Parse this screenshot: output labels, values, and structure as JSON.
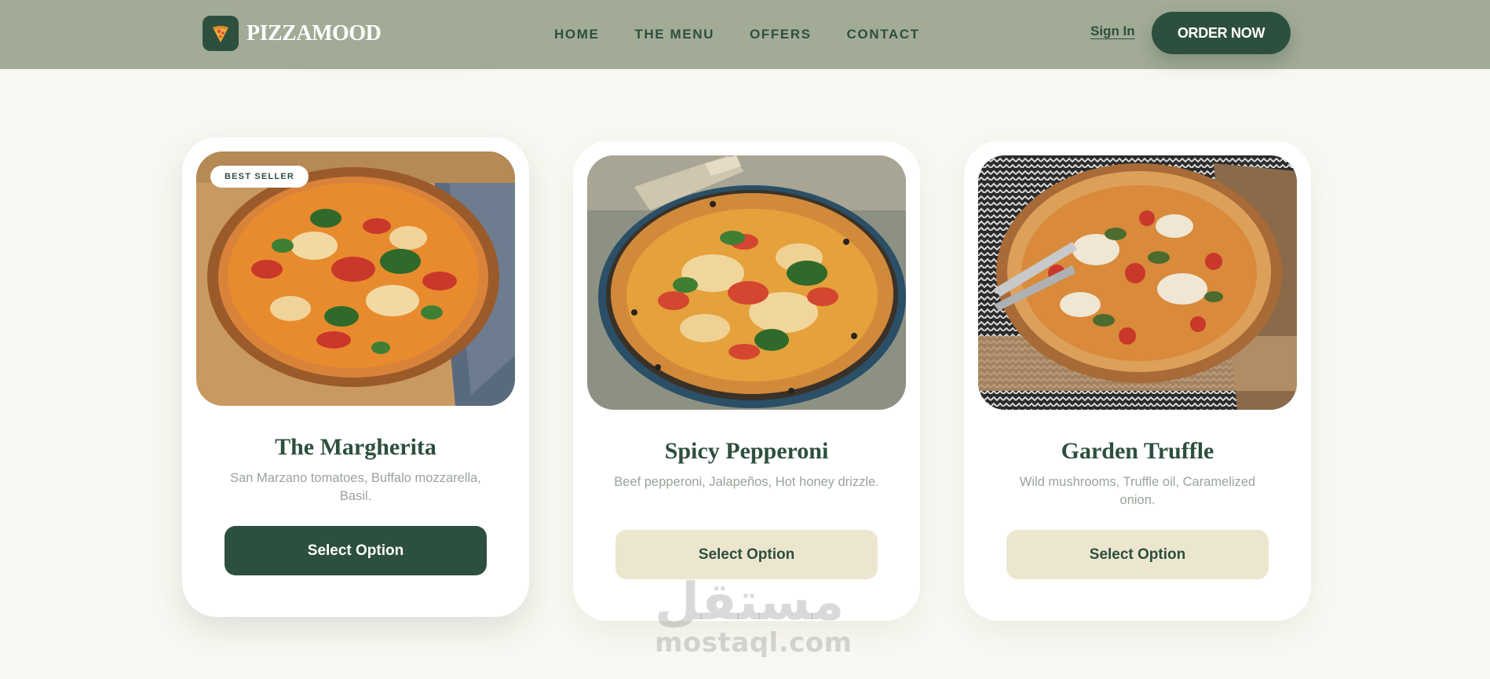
{
  "brand": {
    "name_part1": "PIZZA",
    "name_part2": "MOOD",
    "accent_color": "#2d4f3e",
    "header_color": "#a2ab96",
    "cream_color": "#ede6cf"
  },
  "nav": {
    "items": [
      "HOME",
      "THE MENU",
      "OFFERS",
      "CONTACT"
    ],
    "sign_in": "Sign In",
    "order_now": "ORDER NOW"
  },
  "cards": [
    {
      "badge": "BEST SELLER",
      "title": "The Margherita",
      "description": "San Marzano tomatoes, Buffalo mozzarella, Basil.",
      "button": "Select Option",
      "image": "pizza-margherita-photo",
      "featured": true
    },
    {
      "title": "Spicy Pepperoni",
      "description": "Beef pepperoni, Jalapeños, Hot honey drizzle.",
      "button": "Select Option",
      "image": "pizza-pepperoni-photo"
    },
    {
      "title": "Garden Truffle",
      "description": "Wild mushrooms, Truffle oil, Caramelized onion.",
      "button": "Select Option",
      "image": "pizza-truffle-photo"
    }
  ],
  "watermark": {
    "arabic": "مستقل",
    "latin": "mostaql.com"
  }
}
